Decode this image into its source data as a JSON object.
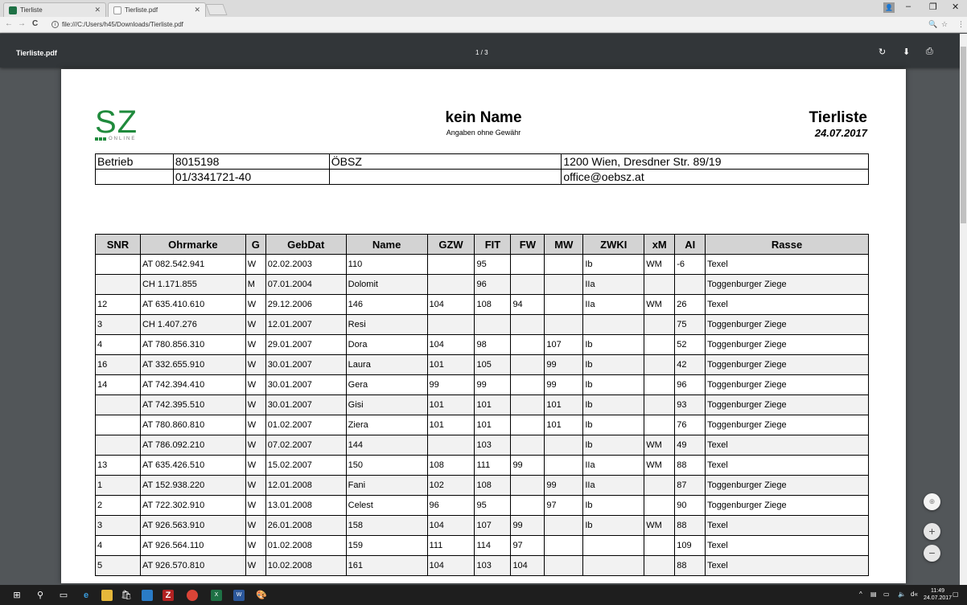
{
  "browser": {
    "tabs": [
      {
        "title": "Tierliste"
      },
      {
        "title": "Tierliste.pdf"
      }
    ],
    "url": "file:///C:/Users/h45/Downloads/Tierliste.pdf"
  },
  "pdf_toolbar": {
    "title": "Tierliste.pdf",
    "page_indicator": "1 / 3"
  },
  "document": {
    "logo_text": "SZ",
    "logo_sub": "ONLINE",
    "name": "kein Name",
    "note": "Angaben ohne Gewähr",
    "doc_title": "Tierliste",
    "date": "24.07.2017",
    "info_rows": [
      [
        "Betrieb",
        "8015198",
        "ÖBSZ",
        "1200 Wien, Dresdner Str. 89/19"
      ],
      [
        "",
        "01/3341721-40",
        "",
        "office@oebsz.at"
      ]
    ],
    "columns": [
      "SNR",
      "Ohrmarke",
      "G",
      "GebDat",
      "Name",
      "GZW",
      "FIT",
      "FW",
      "MW",
      "ZWKI",
      "xM",
      "AI",
      "Rasse"
    ],
    "rows": [
      [
        "",
        "AT 082.542.941",
        "W",
        "02.02.2003",
        "110",
        "",
        "95",
        "",
        "",
        "Ib",
        "WM",
        "-6",
        "Texel"
      ],
      [
        "",
        "CH 1.171.855",
        "M",
        "07.01.2004",
        "Dolomit",
        "",
        "96",
        "",
        "",
        "IIa",
        "",
        "",
        "Toggenburger Ziege"
      ],
      [
        "12",
        "AT 635.410.610",
        "W",
        "29.12.2006",
        "146",
        "104",
        "108",
        "94",
        "",
        "IIa",
        "WM",
        "26",
        "Texel"
      ],
      [
        "3",
        "CH 1.407.276",
        "W",
        "12.01.2007",
        "Resi",
        "",
        "",
        "",
        "",
        "",
        "",
        "75",
        "Toggenburger Ziege"
      ],
      [
        "4",
        "AT 780.856.310",
        "W",
        "29.01.2007",
        "Dora",
        "104",
        "98",
        "",
        "107",
        "Ib",
        "",
        "52",
        "Toggenburger Ziege"
      ],
      [
        "16",
        "AT 332.655.910",
        "W",
        "30.01.2007",
        "Laura",
        "101",
        "105",
        "",
        "99",
        "Ib",
        "",
        "42",
        "Toggenburger Ziege"
      ],
      [
        "14",
        "AT 742.394.410",
        "W",
        "30.01.2007",
        "Gera",
        "99",
        "99",
        "",
        "99",
        "Ib",
        "",
        "96",
        "Toggenburger Ziege"
      ],
      [
        "",
        "AT 742.395.510",
        "W",
        "30.01.2007",
        "Gisi",
        "101",
        "101",
        "",
        "101",
        "Ib",
        "",
        "93",
        "Toggenburger Ziege"
      ],
      [
        "",
        "AT 780.860.810",
        "W",
        "01.02.2007",
        "Ziera",
        "101",
        "101",
        "",
        "101",
        "Ib",
        "",
        "76",
        "Toggenburger Ziege"
      ],
      [
        "",
        "AT 786.092.210",
        "W",
        "07.02.2007",
        "144",
        "",
        "103",
        "",
        "",
        "Ib",
        "WM",
        "49",
        "Texel"
      ],
      [
        "13",
        "AT 635.426.510",
        "W",
        "15.02.2007",
        "150",
        "108",
        "111",
        "99",
        "",
        "IIa",
        "WM",
        "88",
        "Texel"
      ],
      [
        "1",
        "AT 152.938.220",
        "W",
        "12.01.2008",
        "Fani",
        "102",
        "108",
        "",
        "99",
        "IIa",
        "",
        "87",
        "Toggenburger Ziege"
      ],
      [
        "2",
        "AT 722.302.910",
        "W",
        "13.01.2008",
        "Celest",
        "96",
        "95",
        "",
        "97",
        "Ib",
        "",
        "90",
        "Toggenburger Ziege"
      ],
      [
        "3",
        "AT 926.563.910",
        "W",
        "26.01.2008",
        "158",
        "104",
        "107",
        "99",
        "",
        "Ib",
        "WM",
        "88",
        "Texel"
      ],
      [
        "4",
        "AT 926.564.110",
        "W",
        "01.02.2008",
        "159",
        "111",
        "114",
        "97",
        "",
        "",
        "",
        "109",
        "Texel"
      ],
      [
        "5",
        "AT 926.570.810",
        "W",
        "10.02.2008",
        "161",
        "104",
        "103",
        "104",
        "",
        "",
        "",
        "88",
        "Texel"
      ]
    ]
  },
  "taskbar": {
    "time": "11:49",
    "date": "24.07.2017"
  }
}
